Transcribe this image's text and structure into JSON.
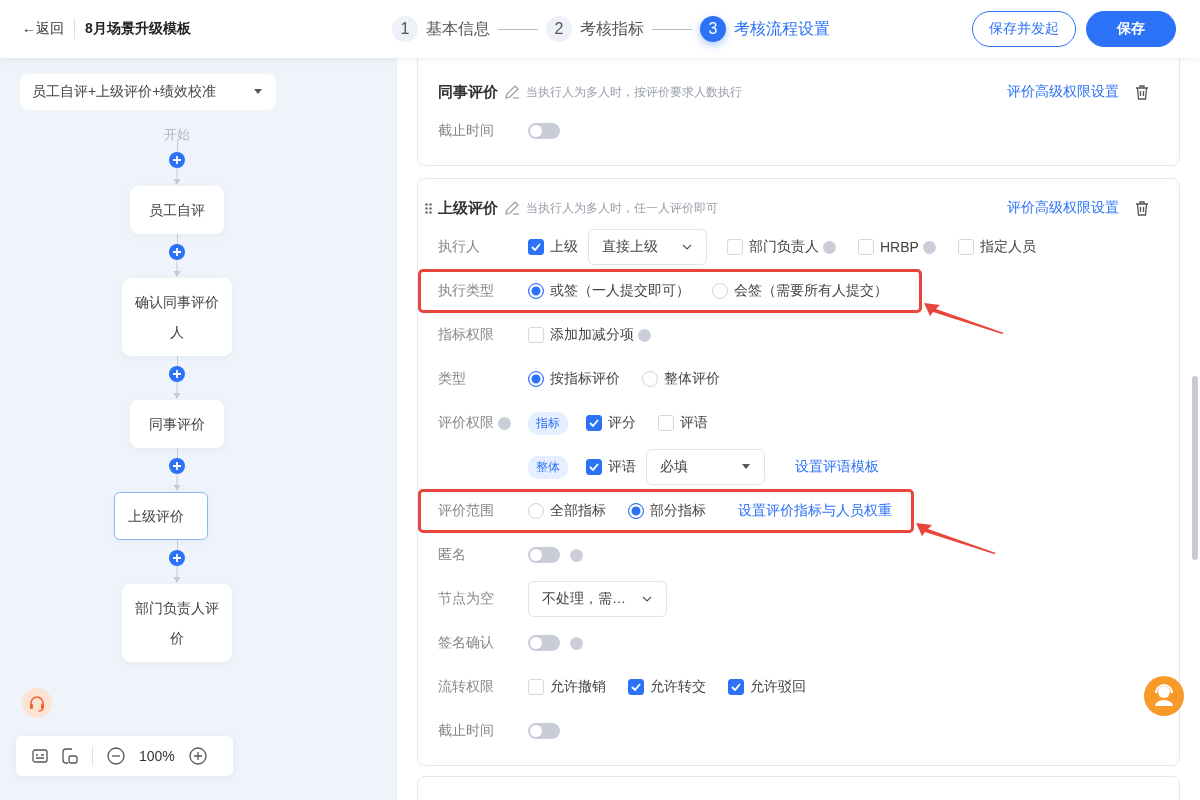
{
  "header": {
    "back": "←返回",
    "title": "8月场景升级模板",
    "steps": [
      {
        "num": "1",
        "label": "基本信息",
        "selected": false
      },
      {
        "num": "2",
        "label": "考核指标",
        "selected": false
      },
      {
        "num": "3",
        "label": "考核流程设置",
        "selected": true
      }
    ],
    "buttons": [
      {
        "label": "保存并发起",
        "kind": "outline"
      },
      {
        "label": "保存",
        "kind": "primary"
      }
    ]
  },
  "flow": {
    "template": "员工自评+上级评价+绩效校准",
    "start": "开始",
    "nodes": [
      {
        "label": "员工自评",
        "selected": false
      },
      {
        "label": "确认同事评价人",
        "selected": false
      },
      {
        "label": "同事评价",
        "selected": false
      },
      {
        "label": "上级评价",
        "selected": true
      },
      {
        "label": "部门负责人评价",
        "selected": false
      }
    ],
    "zoom": "100%"
  },
  "cards": [
    {
      "title": "同事评价",
      "hint": "当执行人为多人时，按评价要求人数执行",
      "link": "评价高级权限设置",
      "handle": false,
      "cut_top": true,
      "rows": [
        {
          "label": "截止时间",
          "help": false,
          "highlighted": false,
          "items": [
            {
              "kind": "toggle",
              "on": false
            }
          ]
        }
      ]
    },
    {
      "title": "上级评价",
      "hint": "当执行人为多人时，任一人评价即可",
      "link": "评价高级权限设置",
      "handle": true,
      "cut_top": false,
      "rows": [
        {
          "label": "执行人",
          "help": false,
          "highlighted": false,
          "items": [
            {
              "kind": "checkbox",
              "label": "上级",
              "checked": true
            },
            {
              "kind": "select",
              "value": "直接上级"
            },
            {
              "kind": "checkbox",
              "label": "部门负责人",
              "checked": false
            },
            {
              "kind": "help"
            },
            {
              "kind": "checkbox",
              "label": "HRBP",
              "checked": false
            },
            {
              "kind": "help"
            },
            {
              "kind": "checkbox",
              "label": "指定人员",
              "checked": false
            }
          ]
        },
        {
          "label": "执行类型",
          "help": false,
          "highlighted": true,
          "items": [
            {
              "kind": "radio",
              "label": "或签（一人提交即可）",
              "selected": true
            },
            {
              "kind": "radio",
              "label": "会签（需要所有人提交）",
              "selected": false
            }
          ]
        },
        {
          "label": "指标权限",
          "help": false,
          "highlighted": false,
          "items": [
            {
              "kind": "checkbox",
              "label": "添加加减分项",
              "checked": false
            },
            {
              "kind": "help"
            }
          ]
        },
        {
          "label": "类型",
          "help": false,
          "highlighted": false,
          "items": [
            {
              "kind": "radio",
              "label": "按指标评价",
              "selected": true
            },
            {
              "kind": "radio",
              "label": "整体评价",
              "selected": false
            }
          ]
        },
        {
          "label": "评价权限",
          "help": true,
          "highlighted": false,
          "items": [
            {
              "kind": "tag",
              "label": "指标"
            },
            {
              "kind": "checkbox",
              "label": "评分",
              "checked": true
            },
            {
              "kind": "checkbox",
              "label": "评语",
              "checked": false
            }
          ]
        },
        {
          "label": "",
          "help": false,
          "highlighted": false,
          "items": [
            {
              "kind": "tag",
              "label": "整体"
            },
            {
              "kind": "checkbox",
              "label": "评语",
              "checked": true
            },
            {
              "kind": "dropdown",
              "value": "必填"
            },
            {
              "kind": "link",
              "label": "设置评语模板"
            }
          ]
        },
        {
          "label": "评价范围",
          "help": false,
          "highlighted": true,
          "items": [
            {
              "kind": "radio",
              "label": "全部指标",
              "selected": false
            },
            {
              "kind": "radio",
              "label": "部分指标",
              "selected": true
            },
            {
              "kind": "link",
              "label": "设置评价指标与人员权重"
            }
          ]
        },
        {
          "label": "匿名",
          "help": false,
          "highlighted": false,
          "items": [
            {
              "kind": "toggle",
              "on": false
            },
            {
              "kind": "help"
            }
          ]
        },
        {
          "label": "节点为空",
          "help": false,
          "highlighted": false,
          "items": [
            {
              "kind": "select",
              "value": "不处理，需…"
            }
          ]
        },
        {
          "label": "签名确认",
          "help": false,
          "highlighted": false,
          "items": [
            {
              "kind": "toggle",
              "on": false
            },
            {
              "kind": "help"
            }
          ]
        },
        {
          "label": "流转权限",
          "help": false,
          "highlighted": false,
          "items": [
            {
              "kind": "checkbox",
              "label": "允许撤销",
              "checked": false
            },
            {
              "kind": "checkbox",
              "label": "允许转交",
              "checked": true
            },
            {
              "kind": "checkbox",
              "label": "允许驳回",
              "checked": true
            }
          ]
        },
        {
          "label": "截止时间",
          "help": false,
          "highlighted": false,
          "items": [
            {
              "kind": "toggle",
              "on": false
            }
          ]
        }
      ]
    }
  ]
}
